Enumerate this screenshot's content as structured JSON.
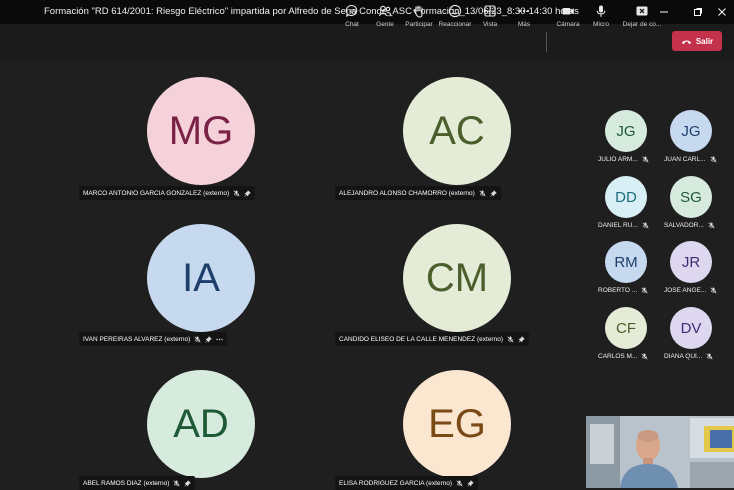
{
  "window": {
    "title": "Formación \"RD 614/2001: Riesgo Eléctrico\" impartida por Alfredo de Sena Conde_ASC Formación_13/06/23_8:30-14:30 horas"
  },
  "window_controls": [
    "minimize-icon",
    "maximize-icon",
    "close-icon"
  ],
  "toolbar": {
    "chat": "Chat",
    "people": "Gente",
    "raise_hand": "Participar",
    "react": "Reaccionar",
    "view": "Vista",
    "more": "Más",
    "camera": "Cámara",
    "mic": "Micro",
    "share": "Dejar de co...",
    "leave": "Salir"
  },
  "colors": {
    "leave_button": "#c4314b",
    "background": "#1f1f1f"
  },
  "main_tiles": [
    {
      "initials": "MG",
      "name": "MARCO ANTONIO GARCIA GONZALEZ (externo)",
      "bg": "#f5d1da",
      "fg": "#7a2245",
      "muted": true,
      "pinned": true,
      "more": false
    },
    {
      "initials": "AC",
      "name": "ALEJANDRO ALONSO CHAMORRO (externo)",
      "bg": "#e4ecd7",
      "fg": "#4b5e2b",
      "muted": true,
      "pinned": true,
      "more": false
    },
    {
      "initials": "IA",
      "name": "IVAN PEREIRAS ALVAREZ (externo)",
      "bg": "#c7d9ef",
      "fg": "#1e3f6b",
      "muted": true,
      "pinned": true,
      "more": true
    },
    {
      "initials": "CM",
      "name": "CANDIDO ELISEO DE LA CALLE MENENDEZ (externo)",
      "bg": "#e4ecd7",
      "fg": "#4b5e2b",
      "muted": true,
      "pinned": true,
      "more": false
    },
    {
      "initials": "AD",
      "name": "ABEL RAMOS DIAZ (externo)",
      "bg": "#d6ebdd",
      "fg": "#1f5a37",
      "muted": true,
      "pinned": true,
      "more": false
    },
    {
      "initials": "EG",
      "name": "ELISA RODRIGUEZ GARCIA (externo)",
      "bg": "#fbe6d0",
      "fg": "#7a4a16",
      "muted": true,
      "pinned": true,
      "more": false
    }
  ],
  "side_tiles": [
    {
      "initials": "JG",
      "name": "JULIO ARM...",
      "bg": "#d6ebdd",
      "fg": "#1f5a37"
    },
    {
      "initials": "JG",
      "name": "JUAN CARL...",
      "bg": "#c7d9ef",
      "fg": "#1e3f6b"
    },
    {
      "initials": "DD",
      "name": "DANIEL RU...",
      "bg": "#d8f0f5",
      "fg": "#1e6b7a"
    },
    {
      "initials": "SG",
      "name": "SALVADOR...",
      "bg": "#d6ebdd",
      "fg": "#1f5a37"
    },
    {
      "initials": "RM",
      "name": "ROBERTO ...",
      "bg": "#c7d9ef",
      "fg": "#1e3f6b"
    },
    {
      "initials": "JR",
      "name": "JOSE ANGE...",
      "bg": "#ddd7f0",
      "fg": "#3d2f73"
    },
    {
      "initials": "CF",
      "name": "CARLOS M...",
      "bg": "#e4ecd7",
      "fg": "#4b5e2b"
    },
    {
      "initials": "DV",
      "name": "DIANA QUI...",
      "bg": "#ddd7f0",
      "fg": "#3d2f73"
    }
  ]
}
